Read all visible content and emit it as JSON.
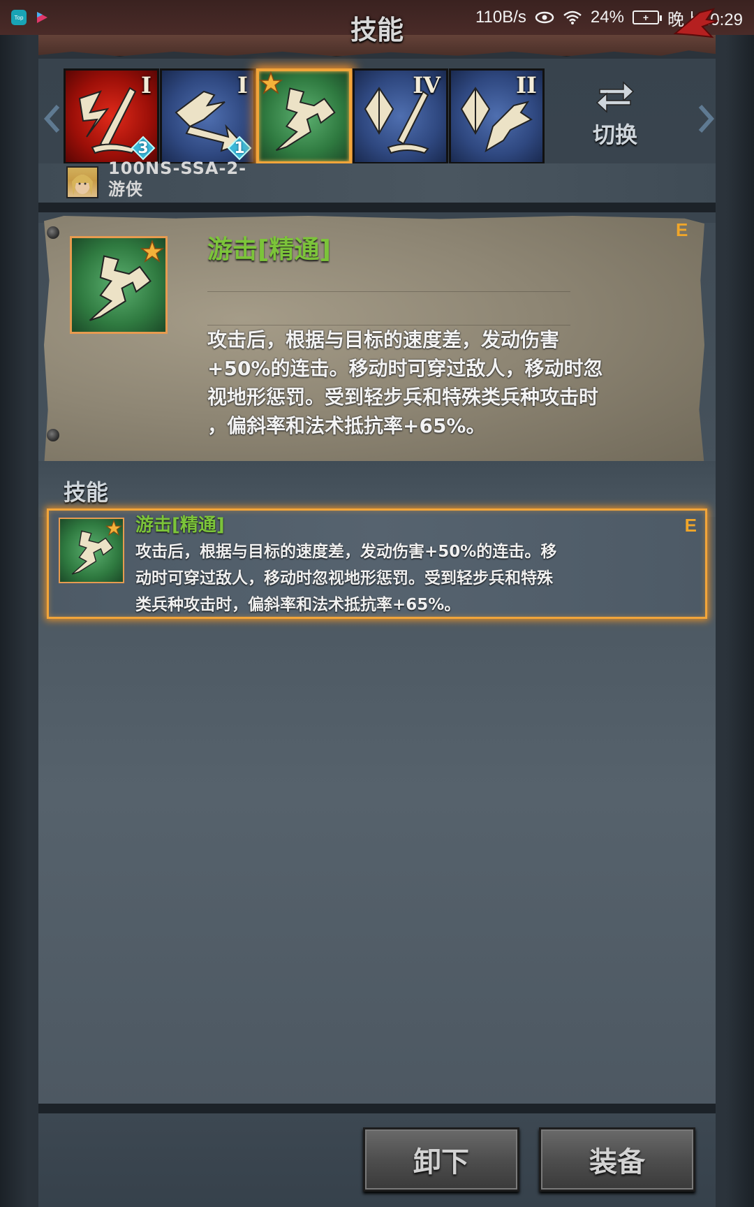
{
  "status_bar": {
    "net_speed": "110B/s",
    "battery": "24%",
    "time": "晚上10:29",
    "app_badge_1": "Top",
    "app_badge_2": "YOUKU"
  },
  "header": {
    "title": "技能"
  },
  "skills": [
    {
      "icon": "slash-sword-icon",
      "color": "red",
      "tier": "I",
      "gem_count": "3",
      "selected": false
    },
    {
      "icon": "dash-arrow-icon",
      "color": "blue",
      "tier": "I",
      "gem_count": "1",
      "selected": false
    },
    {
      "icon": "skirmish-runner-icon",
      "color": "green",
      "tier": "",
      "gem_count": "",
      "selected": true,
      "starred": true
    },
    {
      "icon": "crystal-sword-icon",
      "color": "blue",
      "tier": "IV",
      "gem_count": "",
      "selected": false
    },
    {
      "icon": "crystal-dash-icon",
      "color": "blue",
      "tier": "II",
      "gem_count": "",
      "selected": false
    }
  ],
  "switch": {
    "label": "切换",
    "icon": "swap-arrows-icon"
  },
  "hero": {
    "name": "100NS-SSA-2-游侠"
  },
  "detail": {
    "title": "游击[精通]",
    "grade": "E",
    "description": "攻击后，根据与目标的速度差，发动伤害+50%的连击。移动时可穿过敌人，移动时忽视地形惩罚。受到轻步兵和特殊类兵种攻击时，偏斜率和法术抵抗率+65%。",
    "description_lines": [
      "攻击后，根据与目标的速度差，发动伤害",
      "+50%的连击。移动时可穿过敌人，移动时忽",
      "视地形惩罚。受到轻步兵和特殊类兵种攻击时",
      "，偏斜率和法术抵抗率+65%。"
    ]
  },
  "section": {
    "title": "技能"
  },
  "list": [
    {
      "title": "游击[精通]",
      "grade": "E",
      "description_lines": [
        "攻击后，根据与目标的速度差，发动伤害+50%的连击。移",
        "动时可穿过敌人，移动时忽视地形惩罚。受到轻步兵和特殊",
        "类兵种攻击时，偏斜率和法术抵抗率+65%。"
      ]
    }
  ],
  "buttons": {
    "unequip": "卸下",
    "equip": "装备"
  },
  "colors": {
    "accent_orange": "#f2a53a",
    "skill_name_green": "#7cc43a",
    "grade_orange": "#f0a62a"
  }
}
